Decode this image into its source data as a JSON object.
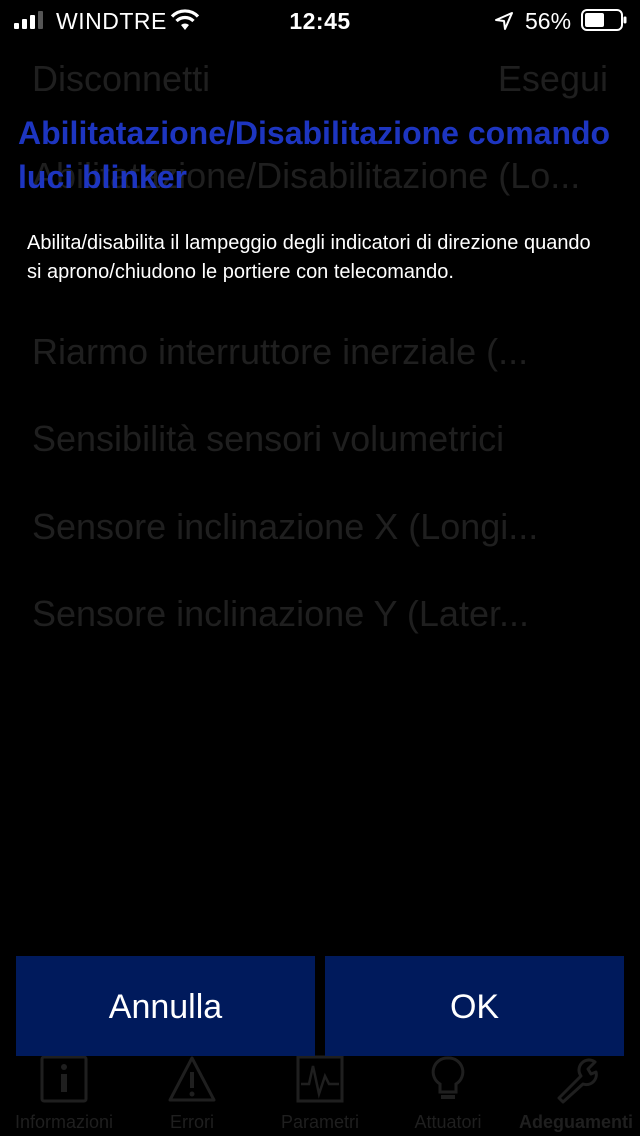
{
  "status_bar": {
    "carrier": "WINDTRE",
    "time": "12:45",
    "battery_percent": "56%",
    "battery_level": 0.56,
    "icons": [
      "signal-icon",
      "wifi-icon",
      "location-arrow-icon",
      "battery-icon"
    ]
  },
  "background": {
    "nav_left": "Disconnetti",
    "nav_right": "Esegui",
    "nav_right_sub": "",
    "rows": [
      "Abilitatazione/Disabilitazione (Lo...",
      "",
      "Riarmo interruttore inerziale (...",
      "Sensibilità sensori volumetrici",
      "Sensore inclinazione X (Longi...",
      "Sensore inclinazione Y (Later..."
    ],
    "tabs": [
      {
        "label": "Informazioni",
        "icon": "info-icon"
      },
      {
        "label": "Errori",
        "icon": "warning-icon"
      },
      {
        "label": "Parametri",
        "icon": "chart-icon"
      },
      {
        "label": "Attuatori",
        "icon": "lightbulb-icon"
      },
      {
        "label": "Adeguamenti",
        "icon": "wrench-icon"
      }
    ]
  },
  "dialog": {
    "title": "Abilitatazione/Disabilitazione comando luci blinker",
    "message": "Abilita/disabilita il lampeggio degli indicatori di direzione quando si aprono/chiudono le portiere con telecomando.",
    "cancel_label": "Annulla",
    "ok_label": "OK"
  },
  "colors": {
    "title": "#1d35c0",
    "button_bg": "#001a5c",
    "background": "#000000",
    "dimmed_text": "#1f1f1f"
  }
}
